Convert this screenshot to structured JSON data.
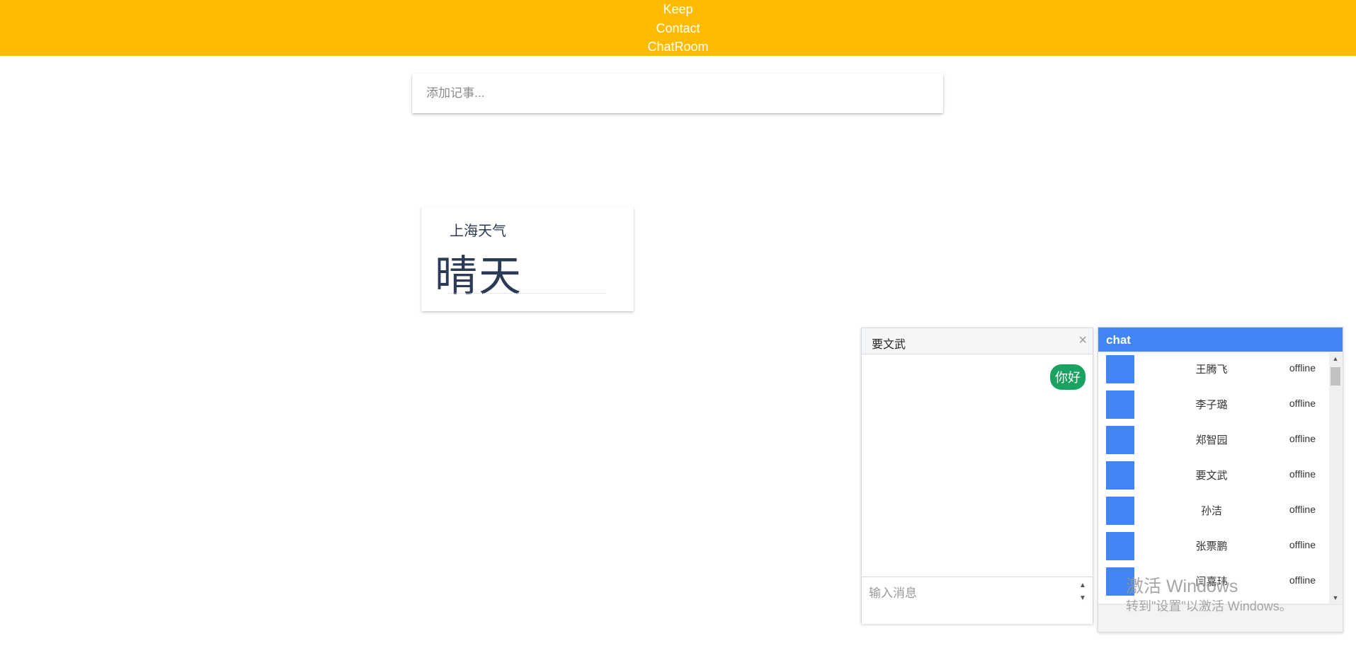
{
  "nav": {
    "items": [
      {
        "label": "Keep"
      },
      {
        "label": "Contact"
      },
      {
        "label": "ChatRoom"
      }
    ],
    "bg_color": "#FFBB00"
  },
  "note_input": {
    "placeholder": "添加记事..."
  },
  "weather_card": {
    "title": "上海天气",
    "value": "晴天"
  },
  "chat_dialog": {
    "title": "要文武",
    "close_symbol": "×",
    "messages": [
      {
        "text": "你好",
        "direction": "sent"
      }
    ],
    "input_placeholder": "输入消息",
    "sent_bubble_color": "#1aa260"
  },
  "contact_panel": {
    "title": "chat",
    "accent_color": "#4285F4",
    "contacts": [
      {
        "name": "王腾飞",
        "status": "offline"
      },
      {
        "name": "李子璐",
        "status": "offline"
      },
      {
        "name": "郑智园",
        "status": "offline"
      },
      {
        "name": "要文武",
        "status": "offline"
      },
      {
        "name": "孙洁",
        "status": "offline"
      },
      {
        "name": "张票鹏",
        "status": "offline"
      },
      {
        "name": "闫嘉玮",
        "status": "offline"
      }
    ]
  },
  "watermark": {
    "title": "激活 Windows",
    "subtitle": "转到\"设置\"以激活 Windows。"
  }
}
